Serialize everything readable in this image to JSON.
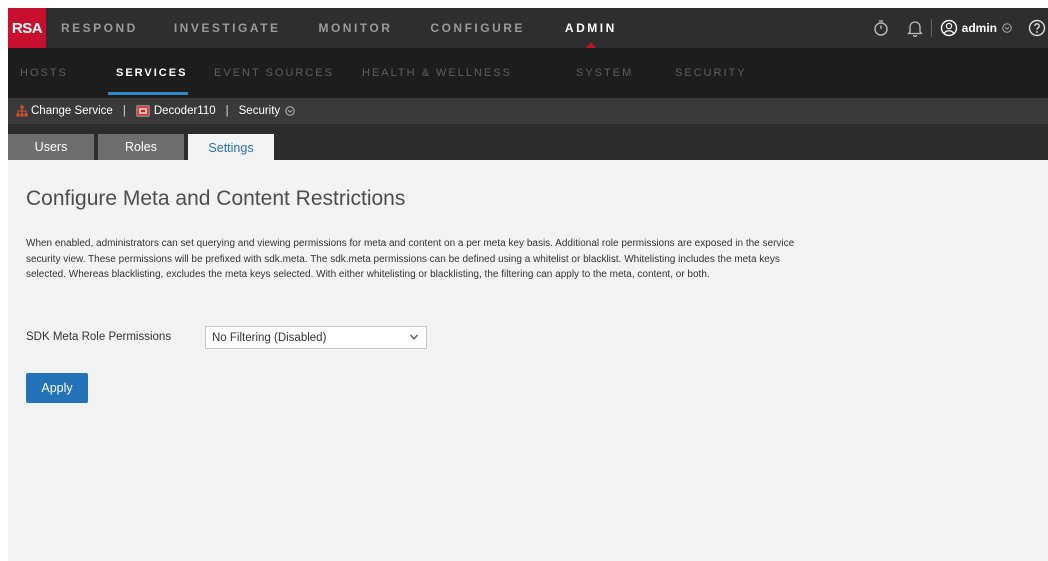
{
  "app": {
    "logo": "RSA"
  },
  "main_nav": [
    {
      "label": "RESPOND",
      "active": false
    },
    {
      "label": "INVESTIGATE",
      "active": false
    },
    {
      "label": "MONITOR",
      "active": false
    },
    {
      "label": "CONFIGURE",
      "active": false
    },
    {
      "label": "ADMIN",
      "active": true
    }
  ],
  "user": {
    "name": "admin"
  },
  "sub_nav": [
    {
      "label": "HOSTS",
      "active": false
    },
    {
      "label": "SERVICES",
      "active": true
    },
    {
      "label": "EVENT SOURCES",
      "active": false
    },
    {
      "label": "HEALTH & WELLNESS",
      "active": false
    },
    {
      "label": "SYSTEM",
      "active": false
    },
    {
      "label": "SECURITY",
      "active": false
    }
  ],
  "service_bar": {
    "change_service": "Change Service",
    "service_name": "Decoder110",
    "view_menu": "Security"
  },
  "tabs": [
    {
      "label": "Users",
      "active": false
    },
    {
      "label": "Roles",
      "active": false
    },
    {
      "label": "Settings",
      "active": true
    }
  ],
  "content": {
    "title": "Configure Meta and Content Restrictions",
    "description": "When enabled, administrators can set querying and viewing permissions for meta and content on a per meta key basis. Additional role permissions are exposed in the service security view. These permissions will be prefixed with sdk.meta. The sdk.meta permissions can be defined using a whitelist or blacklist. Whitelisting includes the meta keys selected. Whereas blacklisting, excludes the meta keys selected. With either whitelisting or blacklisting, the filtering can apply to the meta, content, or both.",
    "field_label": "SDK Meta Role Permissions",
    "select_value": "No Filtering (Disabled)",
    "apply_label": "Apply"
  },
  "colors": {
    "brand_red": "#c8102e",
    "accent_blue": "#2473b8",
    "topbar": "#2e2e2e",
    "subnav": "#1d1d1d"
  },
  "icons": [
    "network-icon",
    "decoder-icon",
    "chevron-down-icon",
    "stopwatch-icon",
    "bell-icon",
    "user-circle-icon",
    "help-icon"
  ]
}
